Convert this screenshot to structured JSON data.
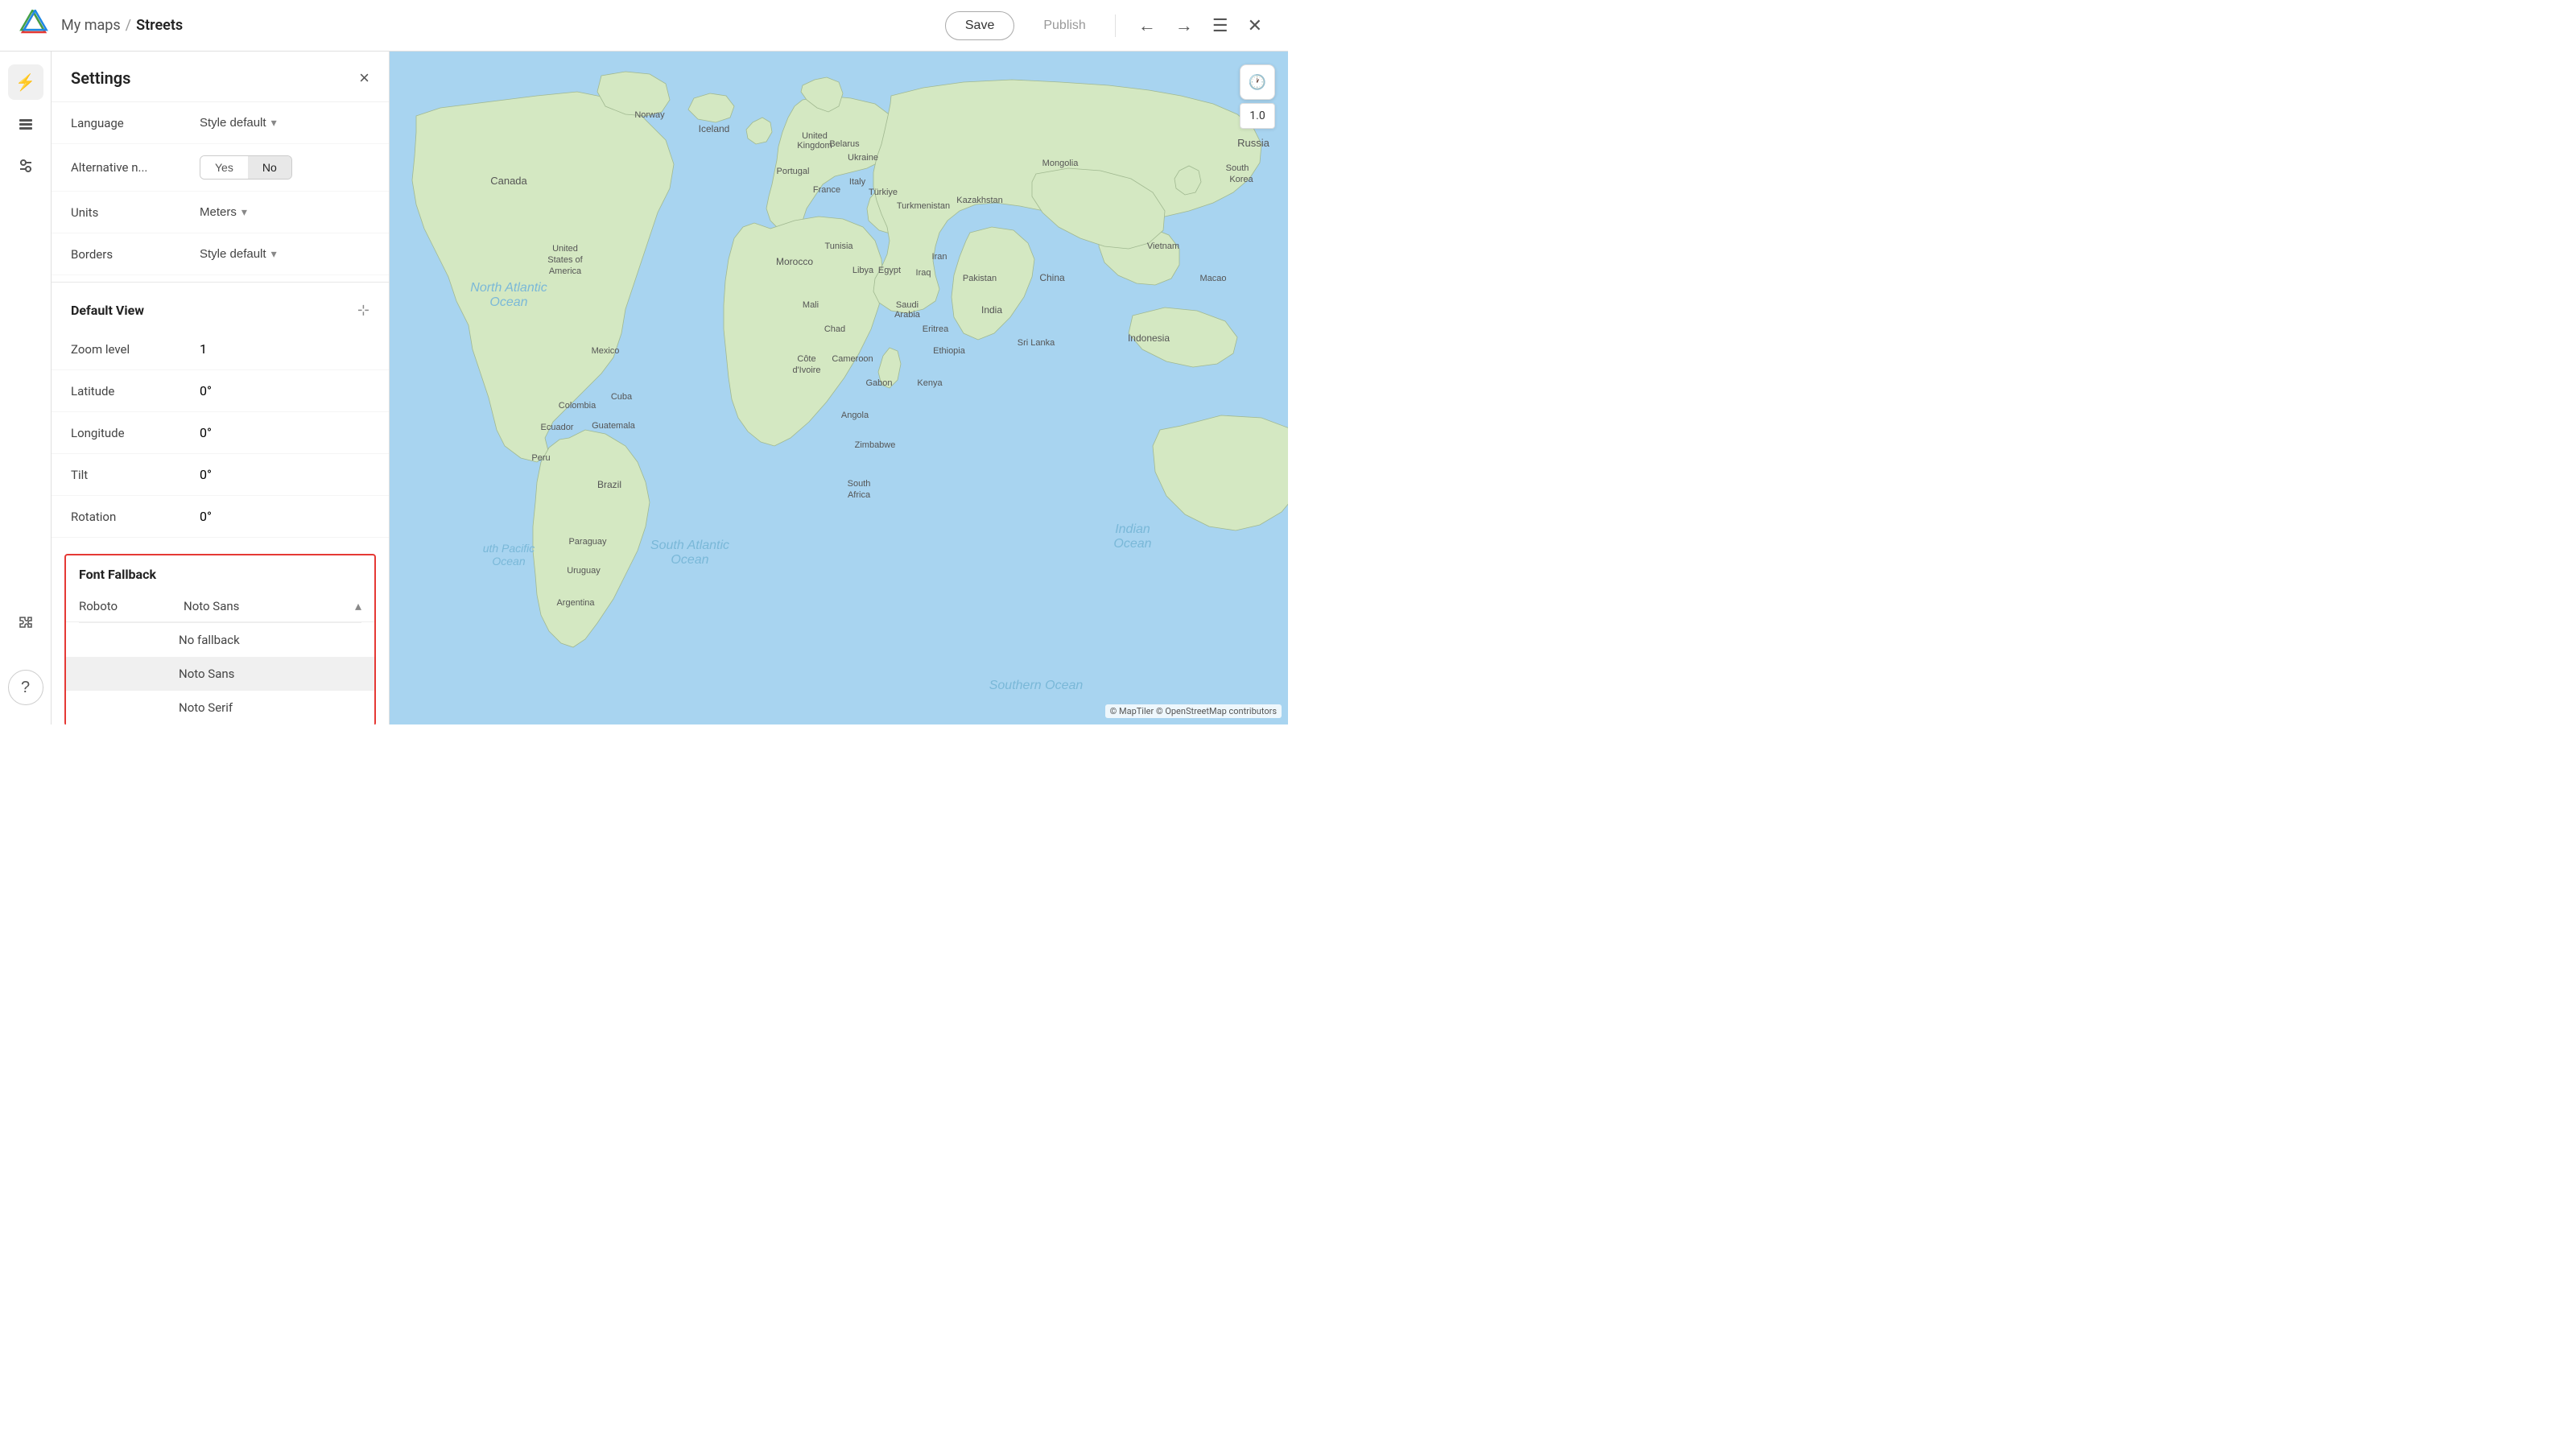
{
  "header": {
    "breadcrumb_parent": "My maps",
    "breadcrumb_sep": "/",
    "breadcrumb_current": "Streets",
    "save_label": "Save",
    "publish_label": "Publish"
  },
  "settings": {
    "title": "Settings",
    "close_icon": "×",
    "rows": [
      {
        "label": "Language",
        "value": "Style default",
        "type": "select"
      },
      {
        "label": "Alternative n...",
        "value_yes": "Yes",
        "value_no": "No",
        "active": "no",
        "type": "toggle"
      },
      {
        "label": "Units",
        "value": "Meters",
        "type": "select"
      },
      {
        "label": "Borders",
        "value": "Style default",
        "type": "select"
      }
    ],
    "default_view": {
      "title": "Default View",
      "zoom_label": "Zoom level",
      "zoom_value": "1",
      "lat_label": "Latitude",
      "lat_value": "0°",
      "lng_label": "Longitude",
      "lng_value": "0°",
      "tilt_label": "Tilt",
      "tilt_value": "0°",
      "rotation_label": "Rotation",
      "rotation_value": "0°"
    },
    "font_fallback": {
      "title": "Font Fallback",
      "font_label": "Roboto",
      "font_value": "Noto Sans",
      "options": [
        "No fallback",
        "Noto Sans",
        "Noto Serif"
      ]
    }
  },
  "map": {
    "zoom_value": "1.0",
    "attribution": "© MapTiler © OpenStreetMap contributors"
  },
  "sidebar_icons": [
    {
      "name": "lightning-icon",
      "symbol": "⚡",
      "active": true
    },
    {
      "name": "layers-icon",
      "symbol": "⧉"
    },
    {
      "name": "sliders-icon",
      "symbol": "⊞"
    },
    {
      "name": "puzzle-icon",
      "symbol": "⬡"
    }
  ]
}
